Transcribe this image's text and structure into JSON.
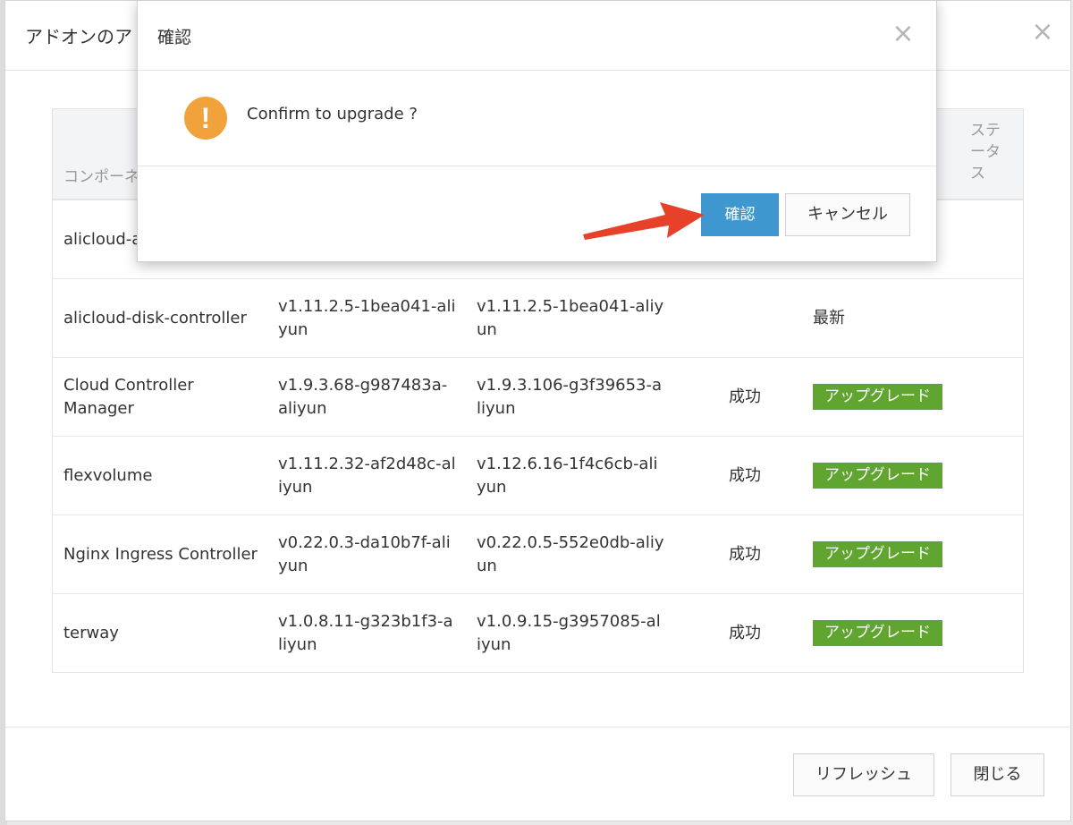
{
  "main_modal": {
    "title": "アドオンのア",
    "close_glyph": "×",
    "table": {
      "headers": {
        "component": "コンポーネ",
        "status": "ステータス"
      },
      "rows": [
        {
          "name": "alicloud-a controller",
          "current": "",
          "next": "",
          "result": "",
          "status": ""
        },
        {
          "name": "alicloud-disk-controller",
          "current": "v1.11.2.5-1bea041-aliyun",
          "next": "v1.11.2.5-1bea041-aliyun",
          "result": "",
          "status": "最新"
        },
        {
          "name": "Cloud Controller Manager",
          "current": "v1.9.3.68-g987483a-aliyun",
          "next": "v1.9.3.106-g3f39653-aliyun",
          "result": "成功",
          "action": "アップグレード"
        },
        {
          "name": "flexvolume",
          "current": "v1.11.2.32-af2d48c-aliyun",
          "next": "v1.12.6.16-1f4c6cb-aliyun",
          "result": "成功",
          "action": "アップグレード"
        },
        {
          "name": "Nginx Ingress Controller",
          "current": "v0.22.0.3-da10b7f-aliyun",
          "next": "v0.22.0.5-552e0db-aliyun",
          "result": "成功",
          "action": "アップグレード"
        },
        {
          "name": "terway",
          "current": "v1.0.8.11-g323b1f3-aliyun",
          "next": "v1.0.9.15-g3957085-aliyun",
          "result": "成功",
          "action": "アップグレード"
        }
      ]
    },
    "footer": {
      "refresh_label": "リフレッシュ",
      "close_label": "閉じる"
    }
  },
  "confirm_dialog": {
    "title": "確認",
    "close_glyph": "×",
    "icon_glyph": "!",
    "message": "Confirm to upgrade ?",
    "ok_label": "確認",
    "cancel_label": "キャンセル"
  },
  "colors": {
    "upgrade_green": "#5fa52f",
    "primary_blue": "#3f97d0",
    "warning_orange": "#f1a23a",
    "arrow_red": "#e8412a"
  }
}
